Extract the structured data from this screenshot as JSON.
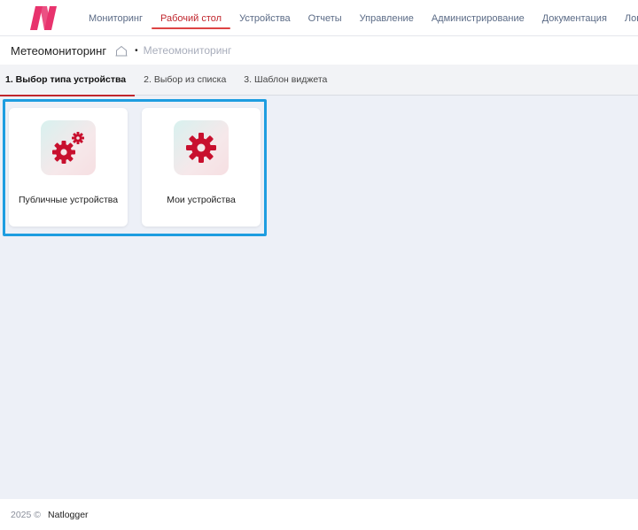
{
  "nav": {
    "items": [
      {
        "label": "Мониторинг"
      },
      {
        "label": "Рабочий стол"
      },
      {
        "label": "Устройства"
      },
      {
        "label": "Отчеты"
      },
      {
        "label": "Управление"
      },
      {
        "label": "Администрирование"
      },
      {
        "label": "Документация"
      },
      {
        "label": "Логи"
      }
    ],
    "active_index": 1
  },
  "breadcrumb": {
    "title": "Метеомониторинг",
    "separator": "•",
    "current": "Метеомониторинг"
  },
  "steps": [
    {
      "label": "1. Выбор типа устройства"
    },
    {
      "label": "2. Выбор из списка"
    },
    {
      "label": "3. Шаблон виджета"
    }
  ],
  "cards": [
    {
      "label": "Публичные устройства",
      "icon": "gears-icon"
    },
    {
      "label": "Мои устройства",
      "icon": "gear-icon"
    }
  ],
  "footer": {
    "year": "2025 ©",
    "brand": "Natlogger"
  },
  "colors": {
    "accent": "#c0262d",
    "logo": "#e8336d",
    "selection": "#1e9de0",
    "icon": "#c8102e"
  }
}
